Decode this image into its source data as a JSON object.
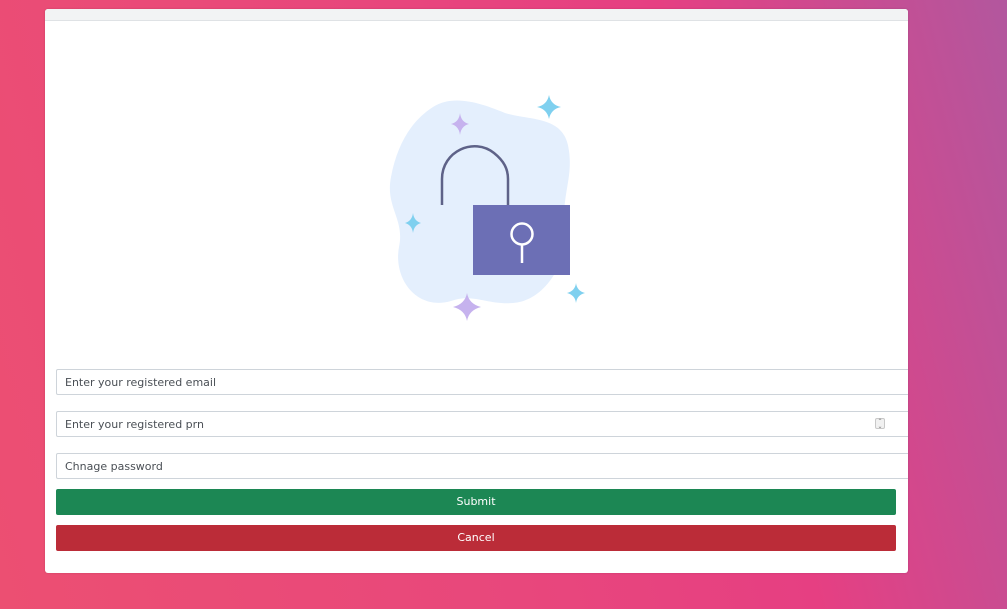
{
  "form": {
    "email_placeholder": "Enter your registered email",
    "prn_placeholder": "Enter your registered prn",
    "password_placeholder": "Chnage password",
    "submit_label": "Submit",
    "cancel_label": "Cancel"
  },
  "icons": {
    "illustration": "padlock-illustration-icon",
    "spinner": "number-spinner-icon"
  },
  "colors": {
    "submit": "#1c8754",
    "cancel": "#bb2c38",
    "lock_body": "#6c6fb5",
    "blob": "#e4effd",
    "sparkle_blue": "#7fd0ef",
    "sparkle_purple": "#c6b2ee"
  }
}
